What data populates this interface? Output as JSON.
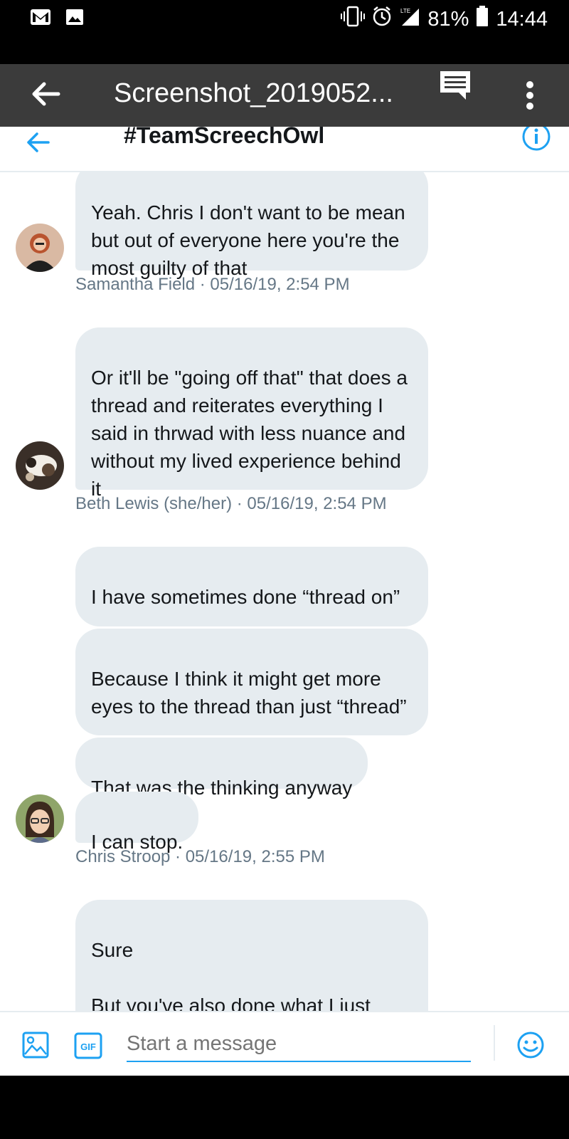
{
  "status_bar": {
    "battery": "81%",
    "time": "14:44",
    "network": "LTE"
  },
  "viewer": {
    "title": "Screenshot_2019052..."
  },
  "header": {
    "title": "#TeamScreechOwl"
  },
  "messages": [
    {
      "bubbles": [
        "Yeah. Chris I don't want to be mean but out of everyone here you're the most guilty of that"
      ],
      "meta": "Samantha Field · 05/16/19, 2:54 PM"
    },
    {
      "bubbles": [
        "Or it'll be \"going off that\" that does a thread and reiterates everything I said in thrwad with less nuance and without my lived experience behind it"
      ],
      "meta": "Beth Lewis (she/her) · 05/16/19, 2:54 PM"
    },
    {
      "bubbles": [
        "I have sometimes done “thread on”",
        "Because I think it might get more eyes to the thread than just “thread”",
        "That was the thinking anyway",
        "I can stop."
      ],
      "meta": "Chris Stroop · 05/16/19, 2:55 PM"
    },
    {
      "bubbles": [
        "Sure\n\nBut you've also done what I just described above so plz do not do"
      ],
      "meta": ""
    }
  ],
  "composer": {
    "placeholder": "Start a message",
    "gif_label": "GIF"
  },
  "colors": {
    "accent": "#1da1f2",
    "bubble": "#e6ecf0",
    "meta": "#657786"
  },
  "icons": [
    "back-arrow-icon",
    "info-icon",
    "image-icon",
    "gif-icon",
    "emoji-icon",
    "comment-icon",
    "more-vert-icon"
  ]
}
